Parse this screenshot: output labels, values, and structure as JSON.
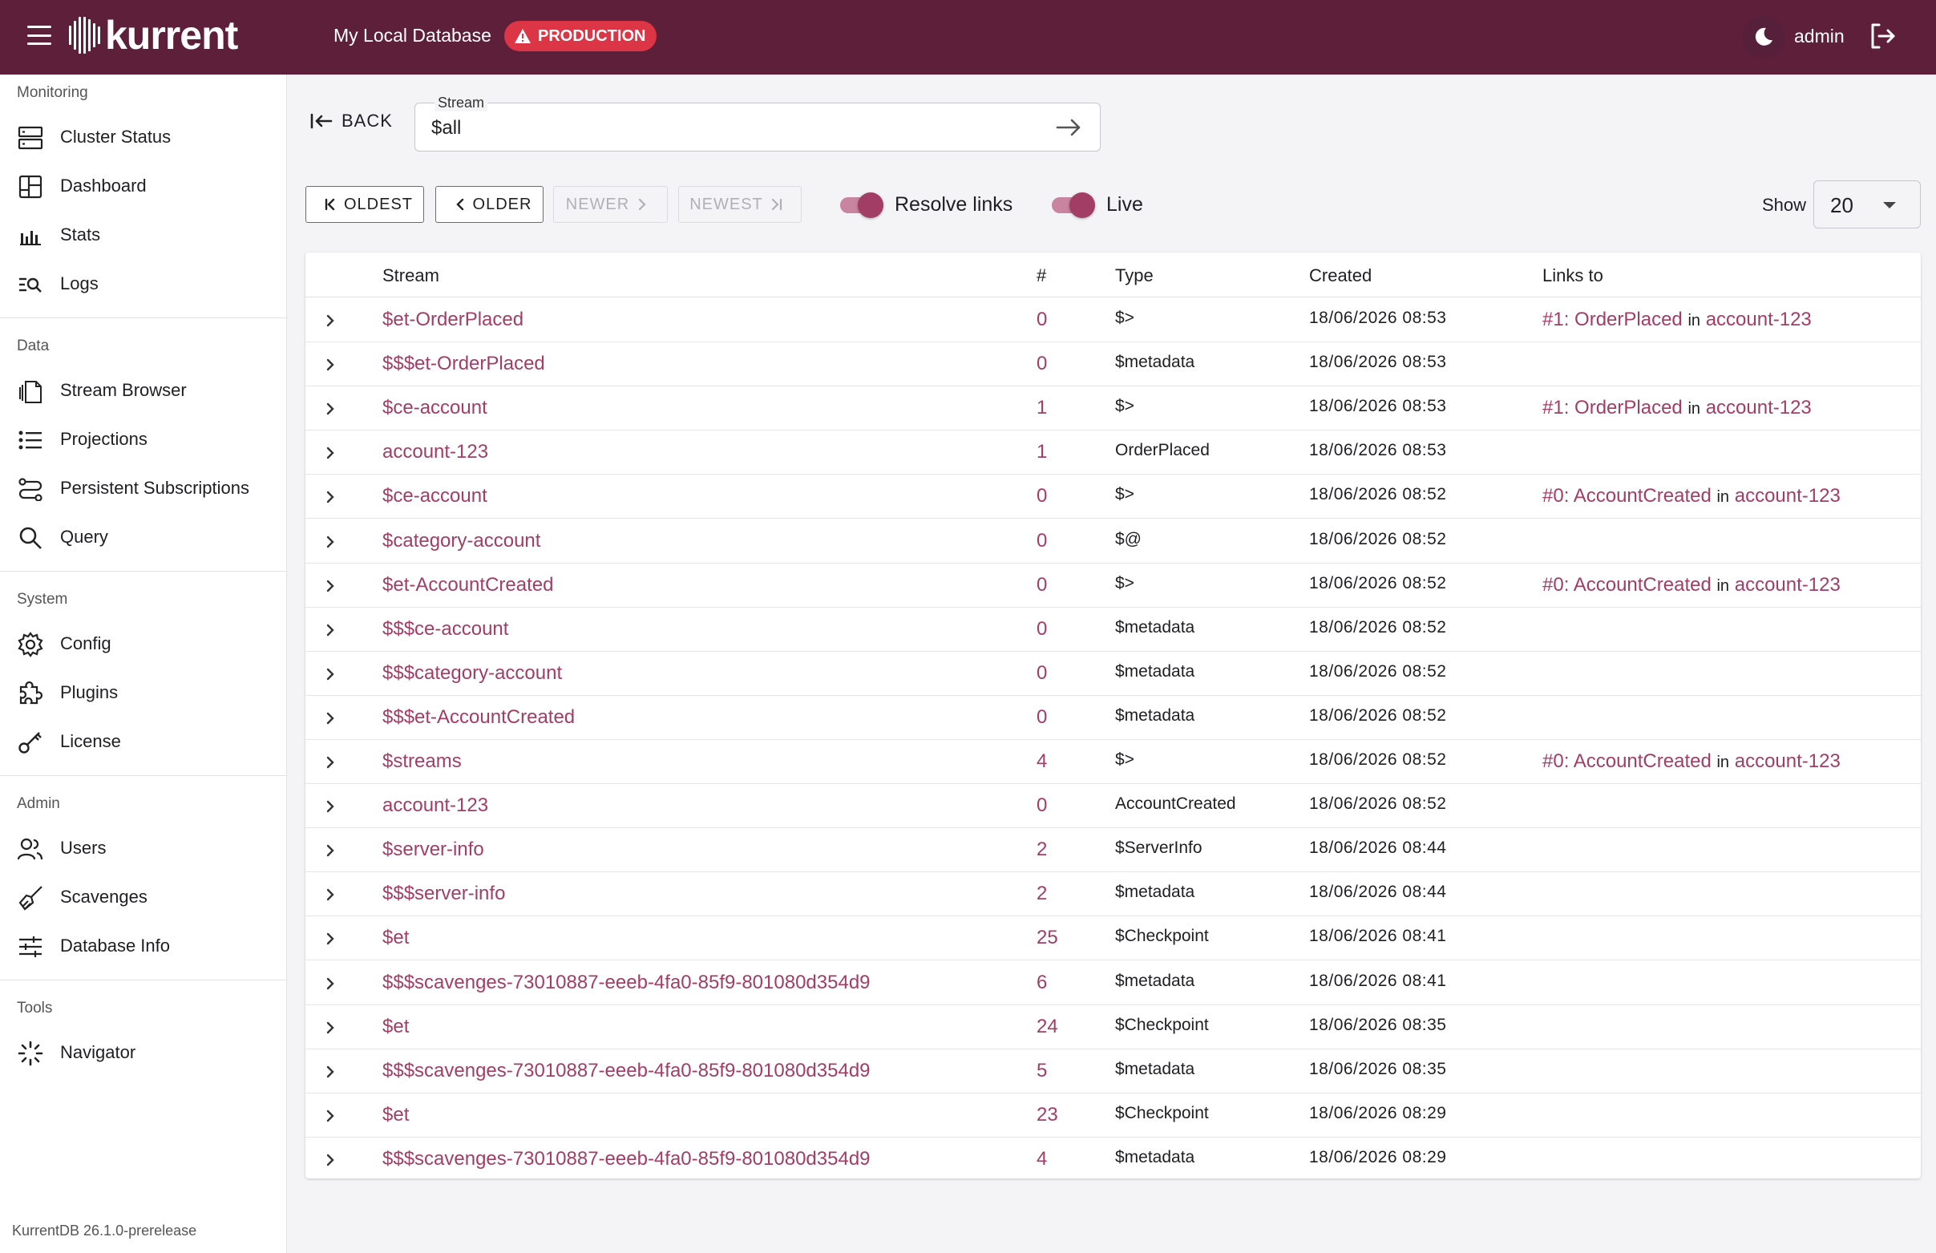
{
  "header": {
    "logo_text": "kurrent",
    "db_name": "My Local Database",
    "env_badge": "PRODUCTION",
    "user": "admin"
  },
  "sidebar": {
    "sections": [
      {
        "label": "Monitoring",
        "items": [
          {
            "label": "Cluster Status",
            "icon": "server-icon"
          },
          {
            "label": "Dashboard",
            "icon": "dashboard-icon"
          },
          {
            "label": "Stats",
            "icon": "bar-chart-icon"
          },
          {
            "label": "Logs",
            "icon": "log-search-icon"
          }
        ]
      },
      {
        "label": "Data",
        "items": [
          {
            "label": "Stream Browser",
            "icon": "files-icon"
          },
          {
            "label": "Projections",
            "icon": "list-icon"
          },
          {
            "label": "Persistent Subscriptions",
            "icon": "route-icon"
          },
          {
            "label": "Query",
            "icon": "search-icon"
          }
        ]
      },
      {
        "label": "System",
        "items": [
          {
            "label": "Config",
            "icon": "gear-icon"
          },
          {
            "label": "Plugins",
            "icon": "puzzle-icon"
          },
          {
            "label": "License",
            "icon": "key-icon"
          }
        ]
      },
      {
        "label": "Admin",
        "items": [
          {
            "label": "Users",
            "icon": "users-icon"
          },
          {
            "label": "Scavenges",
            "icon": "broom-icon"
          },
          {
            "label": "Database Info",
            "icon": "sliders-icon"
          }
        ]
      },
      {
        "label": "Tools",
        "items": [
          {
            "label": "Navigator",
            "icon": "loader-icon"
          }
        ]
      }
    ],
    "version": "KurrentDB 26.1.0-prerelease"
  },
  "toolbar": {
    "back_label": "BACK",
    "stream_label": "Stream",
    "stream_value": "$all",
    "oldest_label": "OLDEST",
    "older_label": "OLDER",
    "newer_label": "NEWER",
    "newest_label": "NEWEST",
    "resolve_links_label": "Resolve links",
    "live_label": "Live",
    "show_label": "Show",
    "show_value": "20"
  },
  "table": {
    "headers": {
      "stream": "Stream",
      "num": "#",
      "type": "Type",
      "created": "Created",
      "links": "Links to"
    },
    "link_in_word": "in",
    "rows": [
      {
        "stream": "$et-OrderPlaced",
        "num": "0",
        "type": "$>",
        "created": "18/06/2026 08:53",
        "link_event": "#1: OrderPlaced",
        "link_stream": "account-123"
      },
      {
        "stream": "$$$et-OrderPlaced",
        "num": "0",
        "type": "$metadata",
        "created": "18/06/2026 08:53",
        "link_event": "",
        "link_stream": ""
      },
      {
        "stream": "$ce-account",
        "num": "1",
        "type": "$>",
        "created": "18/06/2026 08:53",
        "link_event": "#1: OrderPlaced",
        "link_stream": "account-123"
      },
      {
        "stream": "account-123",
        "num": "1",
        "type": "OrderPlaced",
        "created": "18/06/2026 08:53",
        "link_event": "",
        "link_stream": ""
      },
      {
        "stream": "$ce-account",
        "num": "0",
        "type": "$>",
        "created": "18/06/2026 08:52",
        "link_event": "#0: AccountCreated",
        "link_stream": "account-123"
      },
      {
        "stream": "$category-account",
        "num": "0",
        "type": "$@",
        "created": "18/06/2026 08:52",
        "link_event": "",
        "link_stream": ""
      },
      {
        "stream": "$et-AccountCreated",
        "num": "0",
        "type": "$>",
        "created": "18/06/2026 08:52",
        "link_event": "#0: AccountCreated",
        "link_stream": "account-123"
      },
      {
        "stream": "$$$ce-account",
        "num": "0",
        "type": "$metadata",
        "created": "18/06/2026 08:52",
        "link_event": "",
        "link_stream": ""
      },
      {
        "stream": "$$$category-account",
        "num": "0",
        "type": "$metadata",
        "created": "18/06/2026 08:52",
        "link_event": "",
        "link_stream": ""
      },
      {
        "stream": "$$$et-AccountCreated",
        "num": "0",
        "type": "$metadata",
        "created": "18/06/2026 08:52",
        "link_event": "",
        "link_stream": ""
      },
      {
        "stream": "$streams",
        "num": "4",
        "type": "$>",
        "created": "18/06/2026 08:52",
        "link_event": "#0: AccountCreated",
        "link_stream": "account-123"
      },
      {
        "stream": "account-123",
        "num": "0",
        "type": "AccountCreated",
        "created": "18/06/2026 08:52",
        "link_event": "",
        "link_stream": ""
      },
      {
        "stream": "$server-info",
        "num": "2",
        "type": "$ServerInfo",
        "created": "18/06/2026 08:44",
        "link_event": "",
        "link_stream": ""
      },
      {
        "stream": "$$$server-info",
        "num": "2",
        "type": "$metadata",
        "created": "18/06/2026 08:44",
        "link_event": "",
        "link_stream": ""
      },
      {
        "stream": "$et",
        "num": "25",
        "type": "$Checkpoint",
        "created": "18/06/2026 08:41",
        "link_event": "",
        "link_stream": ""
      },
      {
        "stream": "$$$scavenges-73010887-eeeb-4fa0-85f9-801080d354d9",
        "num": "6",
        "type": "$metadata",
        "created": "18/06/2026 08:41",
        "link_event": "",
        "link_stream": ""
      },
      {
        "stream": "$et",
        "num": "24",
        "type": "$Checkpoint",
        "created": "18/06/2026 08:35",
        "link_event": "",
        "link_stream": ""
      },
      {
        "stream": "$$$scavenges-73010887-eeeb-4fa0-85f9-801080d354d9",
        "num": "5",
        "type": "$metadata",
        "created": "18/06/2026 08:35",
        "link_event": "",
        "link_stream": ""
      },
      {
        "stream": "$et",
        "num": "23",
        "type": "$Checkpoint",
        "created": "18/06/2026 08:29",
        "link_event": "",
        "link_stream": ""
      },
      {
        "stream": "$$$scavenges-73010887-eeeb-4fa0-85f9-801080d354d9",
        "num": "4",
        "type": "$metadata",
        "created": "18/06/2026 08:29",
        "link_event": "",
        "link_stream": ""
      }
    ]
  },
  "colors": {
    "header_bg": "#5e1f3a",
    "accent": "#a23d66",
    "badge": "#dc3545"
  }
}
